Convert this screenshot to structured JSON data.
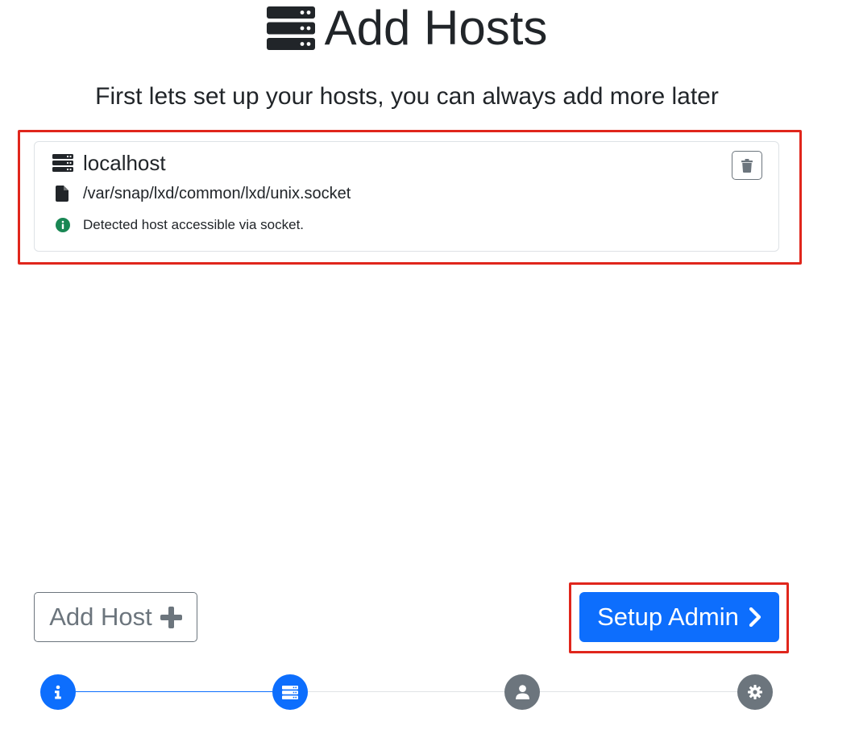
{
  "header": {
    "title": "Add Hosts",
    "title_icon": "server-icon",
    "subtitle": "First lets set up your hosts, you can always add more later"
  },
  "hosts": [
    {
      "name": "localhost",
      "name_icon": "server-icon",
      "socket_path": "/var/snap/lxd/common/lxd/unix.socket",
      "socket_icon": "file-icon",
      "status_message": "Detected host accessible via socket.",
      "status_icon": "info-circle-icon",
      "delete_icon": "trash-icon"
    }
  ],
  "actions": {
    "add_host_label": "Add Host",
    "add_host_icon": "plus-icon",
    "next_label": "Setup Admin",
    "next_icon": "chevron-right-icon"
  },
  "stepper": {
    "steps": [
      {
        "icon": "info-icon",
        "state": "completed"
      },
      {
        "icon": "server-icon",
        "state": "active"
      },
      {
        "icon": "user-icon",
        "state": "pending"
      },
      {
        "icon": "gear-icon",
        "state": "pending"
      }
    ]
  },
  "colors": {
    "primary": "#0d6efd",
    "secondary": "#6c757d",
    "success": "#198754",
    "text": "#212529",
    "annotation": "#e0261c"
  }
}
